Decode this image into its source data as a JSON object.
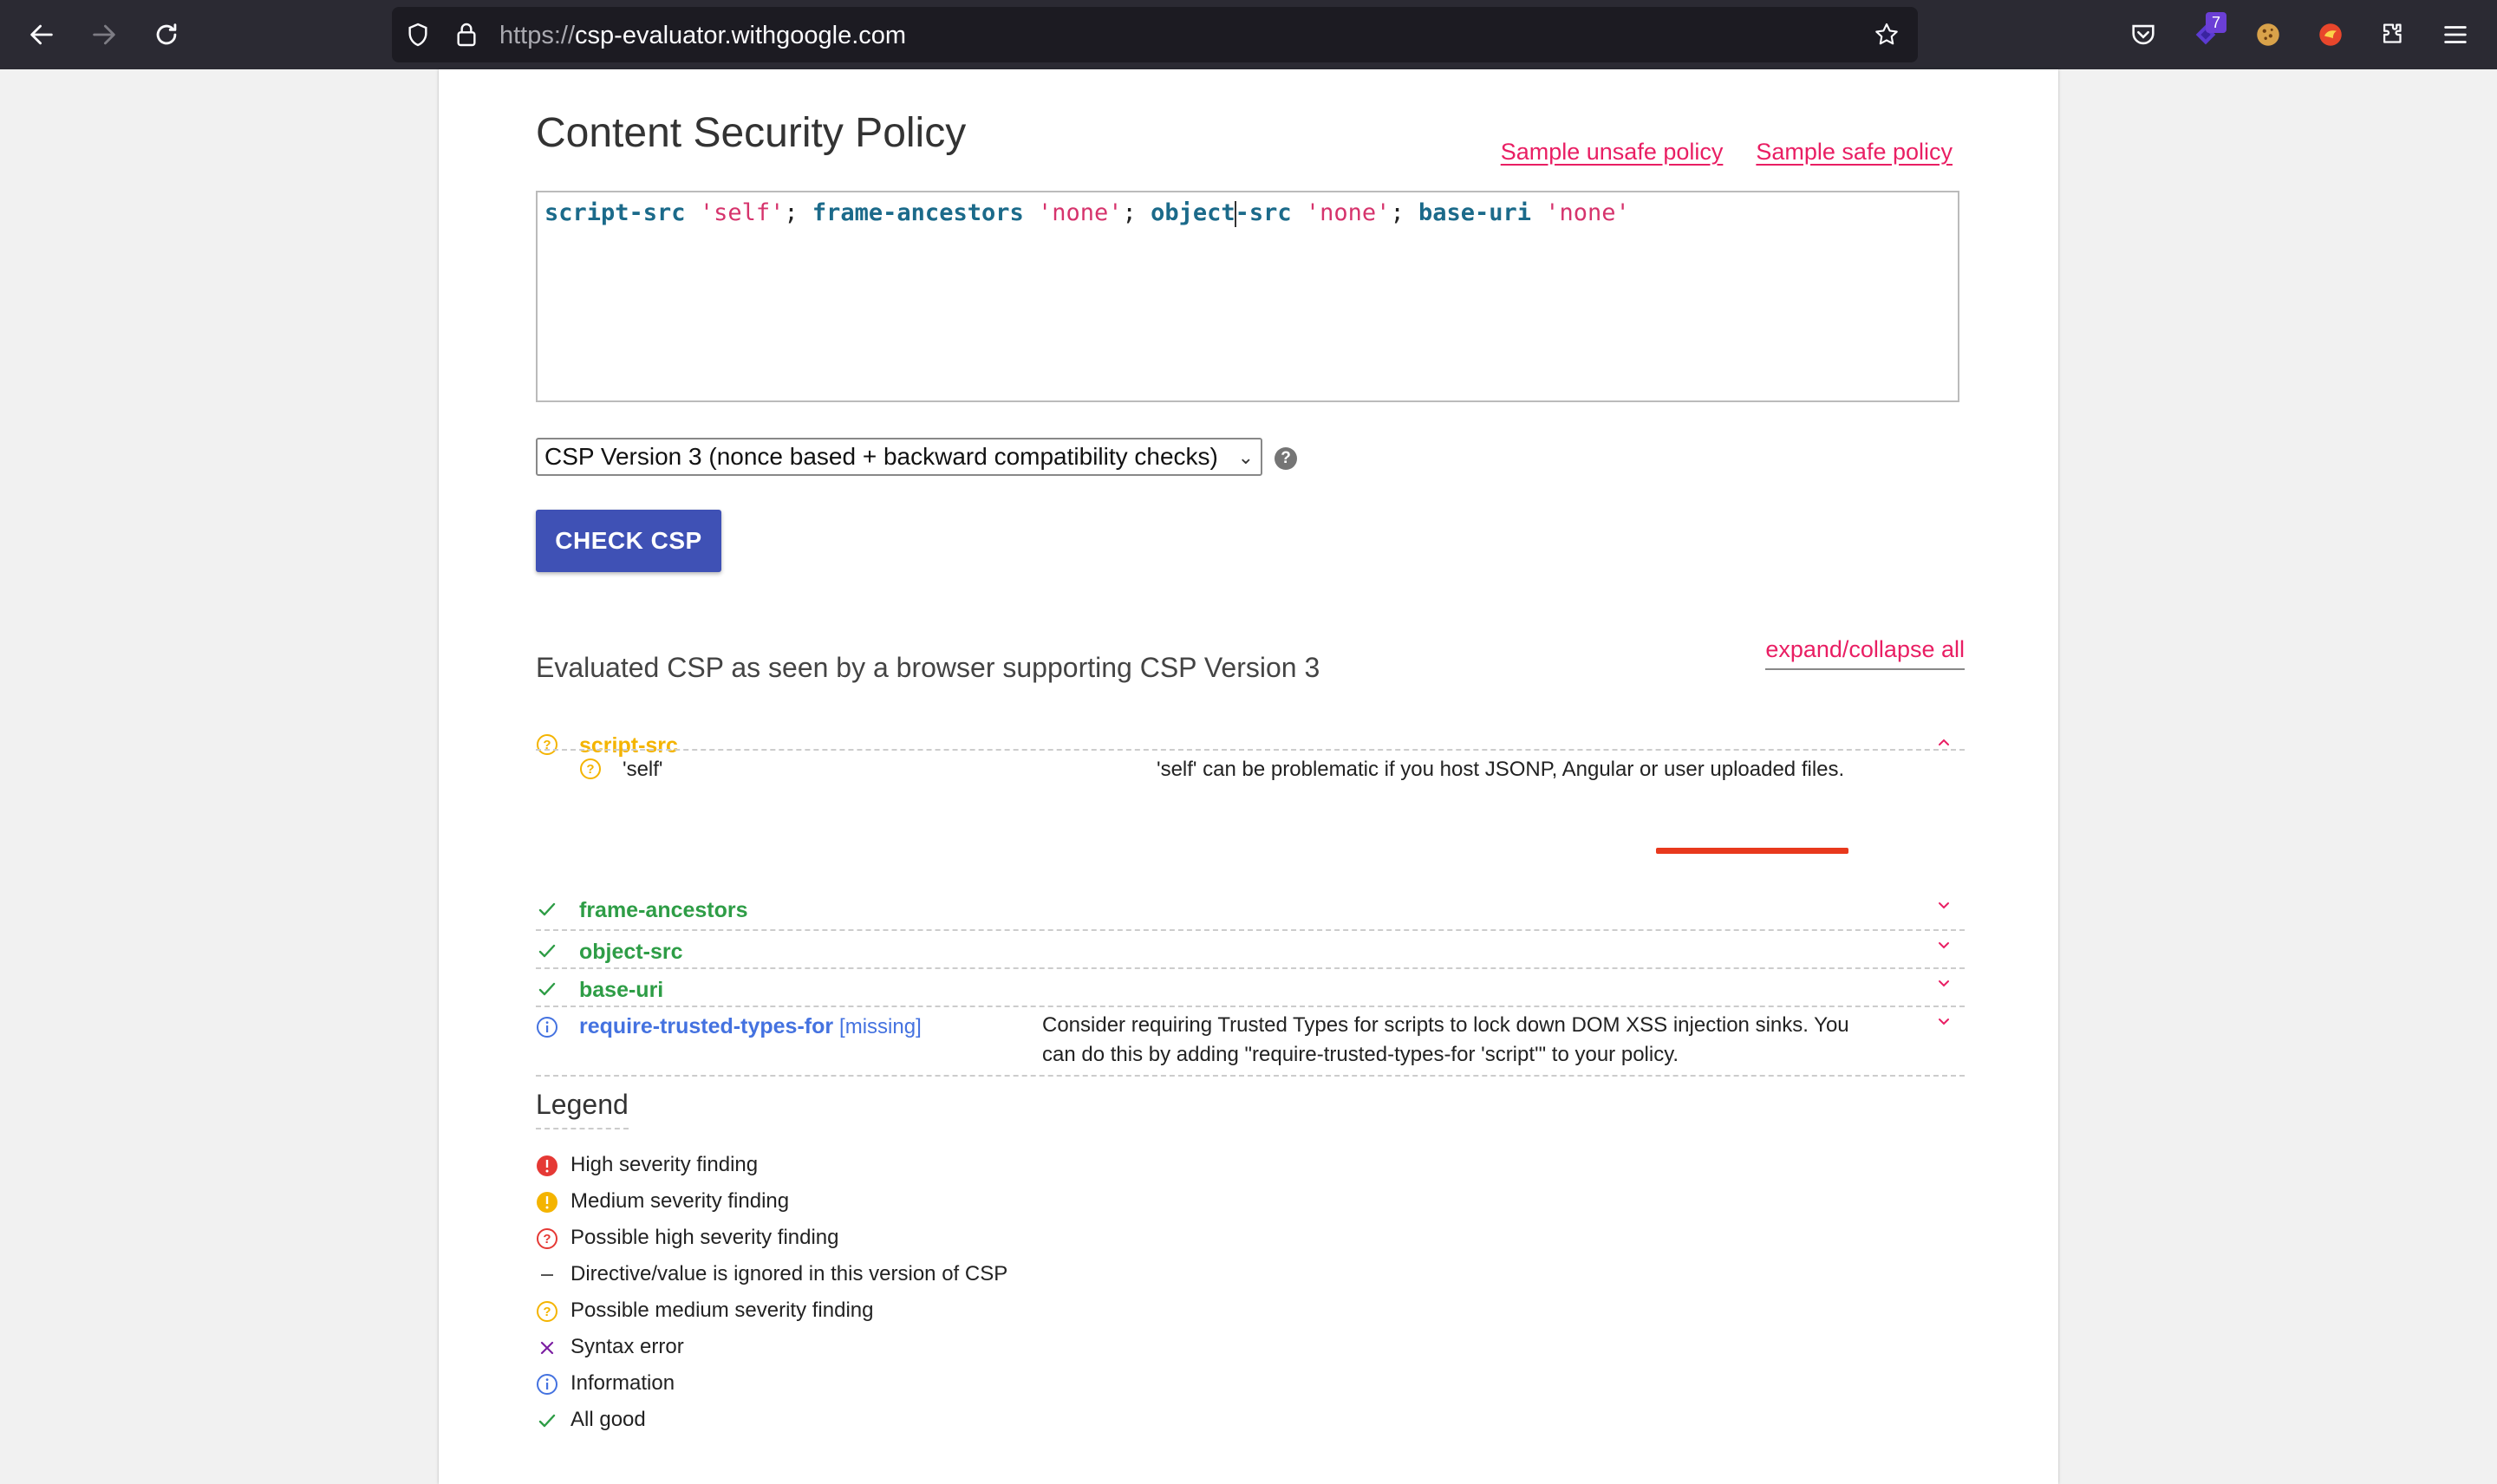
{
  "browser": {
    "url_scheme": "https://",
    "url_host": "csp-evaluator.withgoogle.com",
    "extension_badge": "7"
  },
  "page": {
    "title": "Content Security Policy",
    "sample_unsafe_label": "Sample unsafe policy",
    "sample_safe_label": "Sample safe policy",
    "csp_tokens": [
      {
        "t": "script-src",
        "k": "dir"
      },
      {
        "t": " ",
        "k": "sep"
      },
      {
        "t": "'self'",
        "k": "val"
      },
      {
        "t": "; ",
        "k": "sep"
      },
      {
        "t": "frame-ancestors",
        "k": "dir"
      },
      {
        "t": " ",
        "k": "sep"
      },
      {
        "t": "'none'",
        "k": "val"
      },
      {
        "t": "; ",
        "k": "sep"
      },
      {
        "t": "object",
        "k": "dir"
      },
      {
        "t": "",
        "k": "caret"
      },
      {
        "t": "-src",
        "k": "dir"
      },
      {
        "t": " ",
        "k": "sep"
      },
      {
        "t": "'none'",
        "k": "val"
      },
      {
        "t": "; ",
        "k": "sep"
      },
      {
        "t": "base-uri",
        "k": "dir"
      },
      {
        "t": " ",
        "k": "sep"
      },
      {
        "t": "'none'",
        "k": "val"
      }
    ],
    "version_selected": "CSP Version 3 (nonce based + backward compatibility checks)",
    "help_symbol": "?",
    "check_button": "CHECK CSP",
    "eval_heading": "Evaluated CSP as seen by a browser supporting CSP Version 3",
    "expand_collapse": "expand/collapse all"
  },
  "directives": [
    {
      "name": "script-src",
      "status": "possible-medium",
      "color": "#f4b400",
      "expanded": true,
      "values": [
        {
          "name": "'self'",
          "status": "possible-medium",
          "desc": "'self' can be problematic if you host JSONP, Angular or user uploaded files."
        }
      ]
    },
    {
      "name": "frame-ancestors",
      "status": "all-good",
      "color": "#2e9d46",
      "expanded": false
    },
    {
      "name": "object-src",
      "status": "all-good",
      "color": "#2e9d46",
      "expanded": false
    },
    {
      "name": "base-uri",
      "status": "all-good",
      "color": "#2e9d46",
      "expanded": false
    },
    {
      "name": "require-trusted-types-for",
      "missing_label": "[missing]",
      "status": "information",
      "color": "#4472e0",
      "expanded": false,
      "desc_line1": "Consider requiring Trusted Types for scripts to lock down DOM XSS injection sinks. You",
      "desc_line2": "can do this by adding \"require-trusted-types-for 'script'\" to your policy."
    }
  ],
  "legend": {
    "title": "Legend",
    "items": [
      {
        "label": "High severity finding",
        "icon": "high-severity-icon"
      },
      {
        "label": "Medium severity finding",
        "icon": "medium-severity-icon"
      },
      {
        "label": "Possible high severity finding",
        "icon": "possible-high-severity-icon"
      },
      {
        "label": "Directive/value is ignored in this version of CSP",
        "icon": "ignored-icon"
      },
      {
        "label": "Possible medium severity finding",
        "icon": "possible-medium-severity-icon"
      },
      {
        "label": "Syntax error",
        "icon": "syntax-error-icon"
      },
      {
        "label": "Information",
        "icon": "information-icon"
      },
      {
        "label": "All good",
        "icon": "all-good-icon"
      }
    ]
  },
  "colors": {
    "accent_pink": "#e91e63",
    "button_indigo": "#3f51b5",
    "warning_yellow": "#f4b400",
    "good_green": "#2e9d46",
    "info_blue": "#4472e0",
    "high_red": "#e53935",
    "syntax_purple": "#7b1fa2"
  }
}
